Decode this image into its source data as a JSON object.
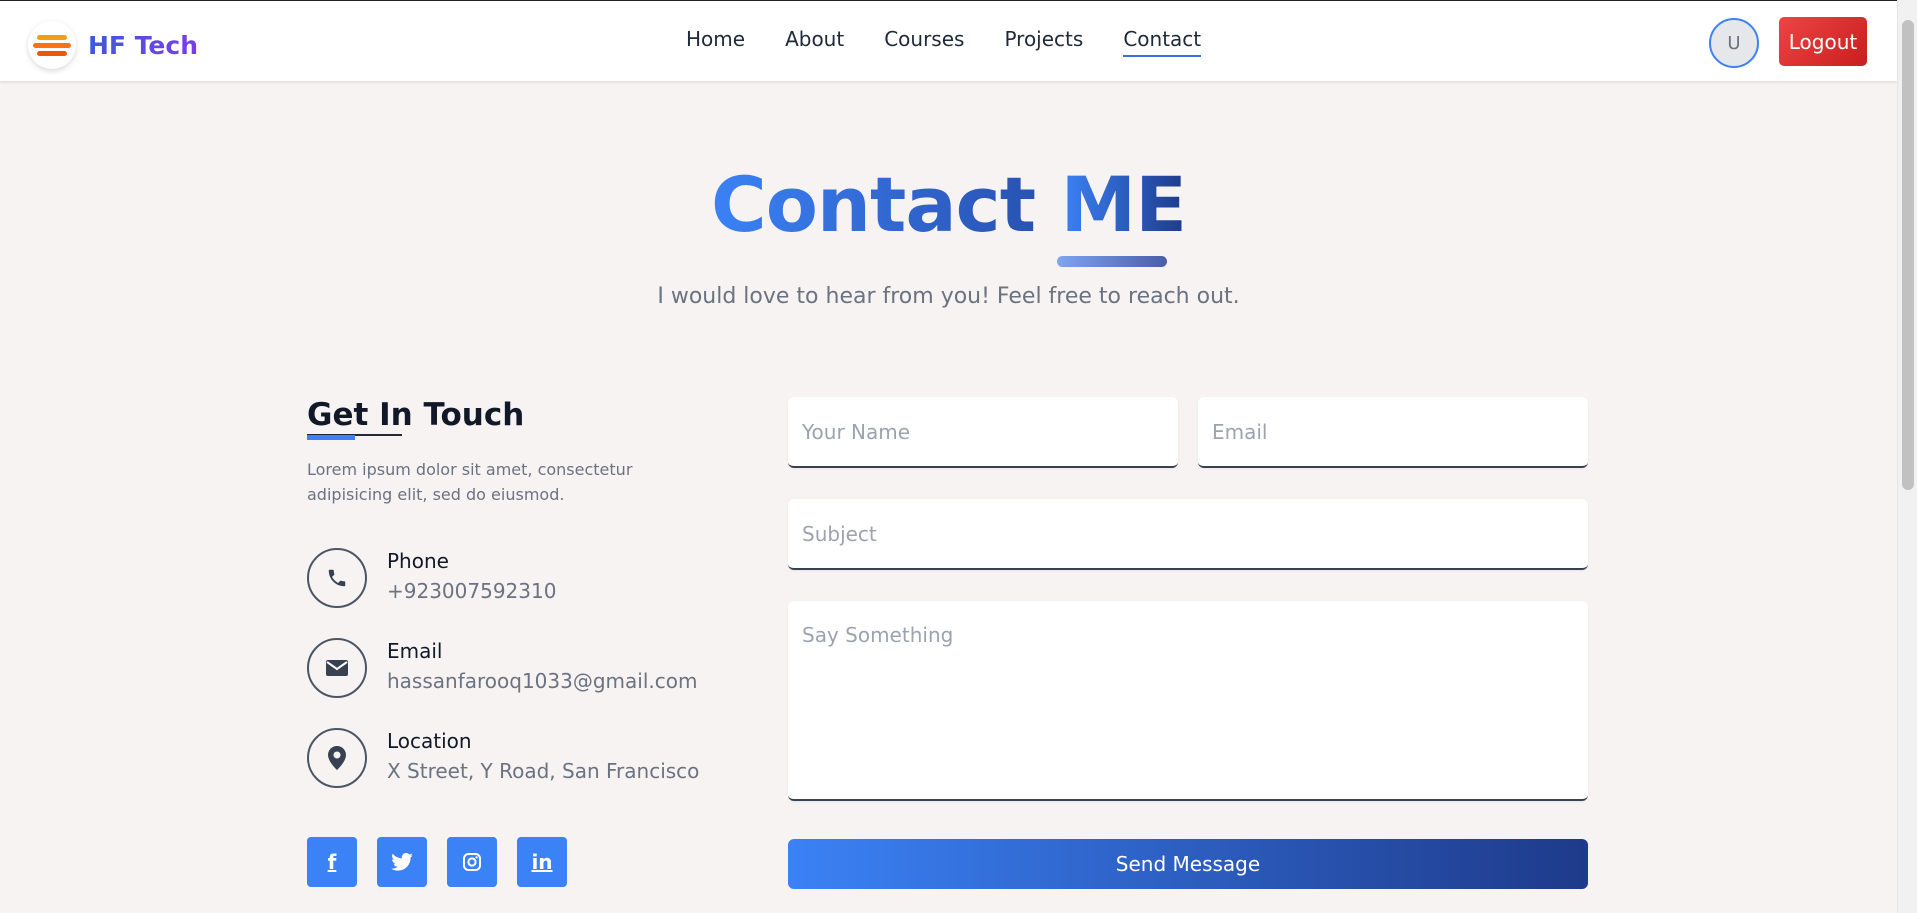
{
  "header": {
    "logo_text": "HF Tech",
    "nav": [
      "Home",
      "About",
      "Courses",
      "Projects",
      "Contact"
    ],
    "active_nav": "Contact",
    "avatar_initial": "U",
    "logout_label": "Logout"
  },
  "hero": {
    "title_word1": "Contact",
    "title_word2": "ME",
    "subtitle": "I would love to hear from you! Feel free to reach out."
  },
  "get_in_touch": {
    "title": "Get In Touch",
    "description": "Lorem ipsum dolor sit amet, consectetur adipisicing elit, sed do eiusmod.",
    "items": [
      {
        "label": "Phone",
        "value": "+923007592310",
        "icon": "phone-icon"
      },
      {
        "label": "Email",
        "value": "hassanfarooq1033@gmail.com",
        "icon": "envelope-icon"
      },
      {
        "label": "Location",
        "value": "X Street, Y Road, San Francisco",
        "icon": "map-pin-icon"
      }
    ],
    "socials": [
      {
        "name": "facebook-icon",
        "glyph": "f"
      },
      {
        "name": "twitter-icon",
        "glyph": ""
      },
      {
        "name": "instagram-icon",
        "glyph": ""
      },
      {
        "name": "linkedin-icon",
        "glyph": "in"
      }
    ]
  },
  "form": {
    "name_placeholder": "Your Name",
    "email_placeholder": "Email",
    "subject_placeholder": "Subject",
    "message_placeholder": "Say Something",
    "send_label": "Send Message"
  },
  "colors": {
    "accent": "#3b82f6",
    "accent_dark": "#1e3a8a",
    "logout": "#dc2626",
    "background": "#f7f3f3"
  }
}
